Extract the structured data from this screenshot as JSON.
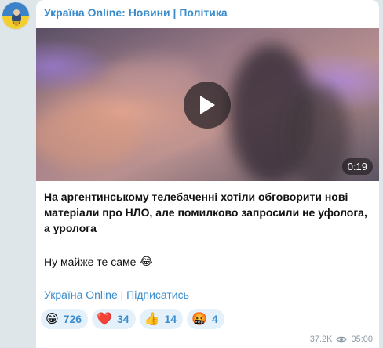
{
  "channel": {
    "title": "Україна Online: Новини | Політика"
  },
  "media": {
    "duration": "0:19",
    "play_icon": "play-icon"
  },
  "message": {
    "headline": "На аргентинському телебаченні хотіли обговорити нові матеріали про НЛО, але помилково запросили не уфолога, а уролога",
    "comment": "Ну майже те саме",
    "comment_emoji": "😂",
    "signature": "Україна Online | Підписатись"
  },
  "reactions": [
    {
      "emoji": "😁",
      "count": "726",
      "icon": "grinning-face-icon"
    },
    {
      "emoji": "❤️",
      "count": "34",
      "icon": "red-heart-icon"
    },
    {
      "emoji": "👍",
      "count": "14",
      "icon": "thumbs-up-icon"
    },
    {
      "emoji": "🤬",
      "count": "4",
      "icon": "angry-face-icon"
    }
  ],
  "meta": {
    "views": "37.2K",
    "time": "05:00",
    "eye_icon": "eye-icon"
  },
  "colors": {
    "accent": "#3a8ccc",
    "reaction_bg": "#e4f1fb",
    "bubble": "#ffffff",
    "chat_bg": "#dfe6ea"
  }
}
